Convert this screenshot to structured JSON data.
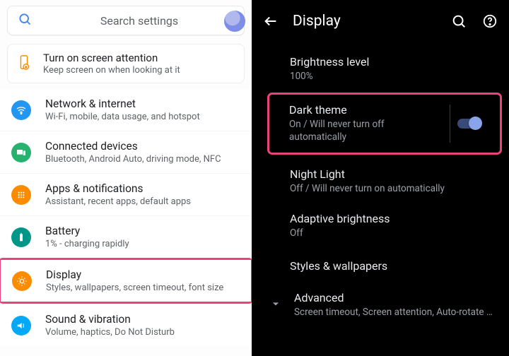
{
  "left": {
    "search_placeholder": "Search settings",
    "suggestion": {
      "title": "Turn on screen attention",
      "subtitle": "Keep screen on when looking at it"
    },
    "items": [
      {
        "key": "network",
        "icon": "wifi-icon",
        "title": "Network & internet",
        "subtitle": "Wi-Fi, mobile, data usage, and hotspot"
      },
      {
        "key": "devices",
        "icon": "devices-icon",
        "title": "Connected devices",
        "subtitle": "Bluetooth, Android Auto, driving mode, NFC"
      },
      {
        "key": "apps",
        "icon": "apps-icon",
        "title": "Apps & notifications",
        "subtitle": "Assistant, recent apps, default apps"
      },
      {
        "key": "battery",
        "icon": "battery-icon",
        "title": "Battery",
        "subtitle": "1% - charging rapidly"
      },
      {
        "key": "display",
        "icon": "display-icon",
        "title": "Display",
        "subtitle": "Styles, wallpapers, screen timeout, font size",
        "highlight": true
      },
      {
        "key": "sound",
        "icon": "sound-icon",
        "title": "Sound & vibration",
        "subtitle": "Volume, haptics, Do Not Disturb"
      }
    ]
  },
  "right": {
    "title": "Display",
    "items": {
      "brightness": {
        "title": "Brightness level",
        "subtitle": "100%"
      },
      "dark_theme": {
        "title": "Dark theme",
        "subtitle": "On / Will never turn off automatically",
        "toggle": true,
        "highlight": true
      },
      "night_light": {
        "title": "Night Light",
        "subtitle": "Off / Will never turn on automatically"
      },
      "adaptive": {
        "title": "Adaptive brightness",
        "subtitle": "Off"
      },
      "styles": {
        "title": "Styles & wallpapers"
      },
      "advanced": {
        "title": "Advanced",
        "subtitle": "Screen timeout, Screen attention, Auto-rotate s.."
      }
    }
  },
  "colors": {
    "highlight": "#e9447a",
    "blue": "#2196f3",
    "green": "#27b36f",
    "orange": "#fb8c00",
    "teal": "#009688",
    "cyan": "#03a9f4"
  }
}
